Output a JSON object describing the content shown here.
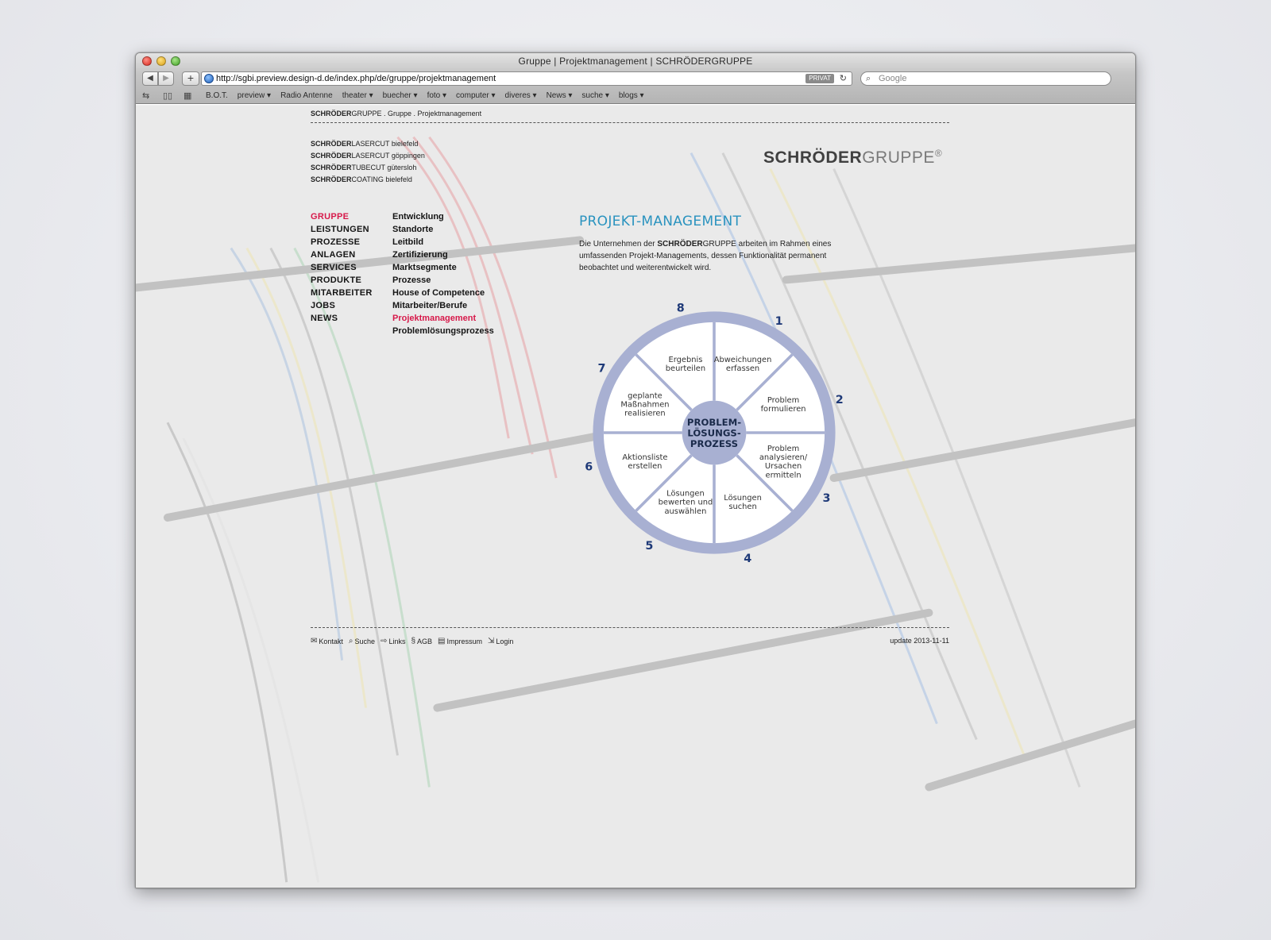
{
  "browser": {
    "window_title": "Gruppe | Projektmanagement | SCHRÖDERGRUPPE",
    "back": "◀",
    "forward": "▶",
    "add_tab": "+",
    "url": "http://sgbi.preview.design-d.de/index.php/de/gruppe/projektmanagement",
    "privat_badge": "PRIVAT",
    "search_placeholder": "Google",
    "bookmarks": [
      "B.O.T.",
      "preview ▾",
      "Radio Antenne",
      "theater ▾",
      "buecher ▾",
      "foto ▾",
      "computer ▾",
      "diveres ▾",
      "News ▾",
      "suche ▾",
      "blogs ▾"
    ]
  },
  "breadcrumb": {
    "brand_bold": "SCHRÖDER",
    "brand_light": "GRUPPE",
    "trail": " . Gruppe . Projektmanagement"
  },
  "subsidiaries": [
    {
      "bold": "SCHRÖDER",
      "light": "LASERCUT bielefeld"
    },
    {
      "bold": "SCHRÖDER",
      "light": "LASERCUT göppingen"
    },
    {
      "bold": "SCHRÖDER",
      "light": "TUBECUT gütersloh"
    },
    {
      "bold": "SCHRÖDER",
      "light": "COATING bielefeld"
    }
  ],
  "logo": {
    "bold": "SCHRÖDER",
    "light": "GRUPPE",
    "mark": "®"
  },
  "main_nav": [
    "GRUPPE",
    "LEISTUNGEN",
    "PROZESSE",
    "ANLAGEN",
    "SERVICES",
    "PRODUKTE",
    "MITARBEITER",
    "JOBS",
    "NEWS"
  ],
  "sub_nav": [
    "Entwicklung",
    "Standorte",
    "Leitbild",
    "Zertifizierung",
    "Marktsegmente",
    "Prozesse",
    "House of Competence",
    "Mitarbeiter/Berufe",
    "Projektmanagement",
    "Problemlösungsprozess"
  ],
  "content": {
    "headline": "PROJEKT-MANAGEMENT",
    "intro_a": "Die Unternehmen der ",
    "intro_brand_bold": "SCHRÖDER",
    "intro_brand_light": "GRUPPE",
    "intro_b": " arbeiten im Rahmen eines umfassenden Projekt-Managements, dessen Funktionalität permanent beobachtet und weiterentwickelt wird."
  },
  "diagram": {
    "center": [
      "PROBLEM-",
      "LÖSUNGS-",
      "PROZESS"
    ],
    "segments": [
      {
        "number": "1",
        "lines": [
          "Abweichungen",
          "erfassen"
        ]
      },
      {
        "number": "2",
        "lines": [
          "Problem",
          "formulieren"
        ]
      },
      {
        "number": "3",
        "lines": [
          "Problem",
          "analysieren/",
          "Ursachen",
          "ermitteln"
        ]
      },
      {
        "number": "4",
        "lines": [
          "Lösungen",
          "suchen"
        ]
      },
      {
        "number": "5",
        "lines": [
          "Lösungen",
          "bewerten und",
          "auswählen"
        ]
      },
      {
        "number": "6",
        "lines": [
          "Aktionsliste",
          "erstellen"
        ]
      },
      {
        "number": "7",
        "lines": [
          "geplante",
          "Maßnahmen",
          "realisieren"
        ]
      },
      {
        "number": "8",
        "lines": [
          "Ergebnis",
          "beurteilen"
        ]
      }
    ],
    "colors": {
      "ring": "#a8b0d2",
      "fill": "#ffffff",
      "numbers": "#1f3a78",
      "hub": "#a8b0d2"
    }
  },
  "footer": {
    "links": [
      {
        "icon": "✉",
        "label": "Kontakt"
      },
      {
        "icon": "⌕",
        "label": "Suche"
      },
      {
        "icon": "⇨",
        "label": "Links"
      },
      {
        "icon": "§",
        "label": "AGB"
      },
      {
        "icon": "▤",
        "label": "Impressum"
      },
      {
        "icon": "⇲",
        "label": "Login"
      }
    ],
    "update": "update 2013-11-11"
  }
}
